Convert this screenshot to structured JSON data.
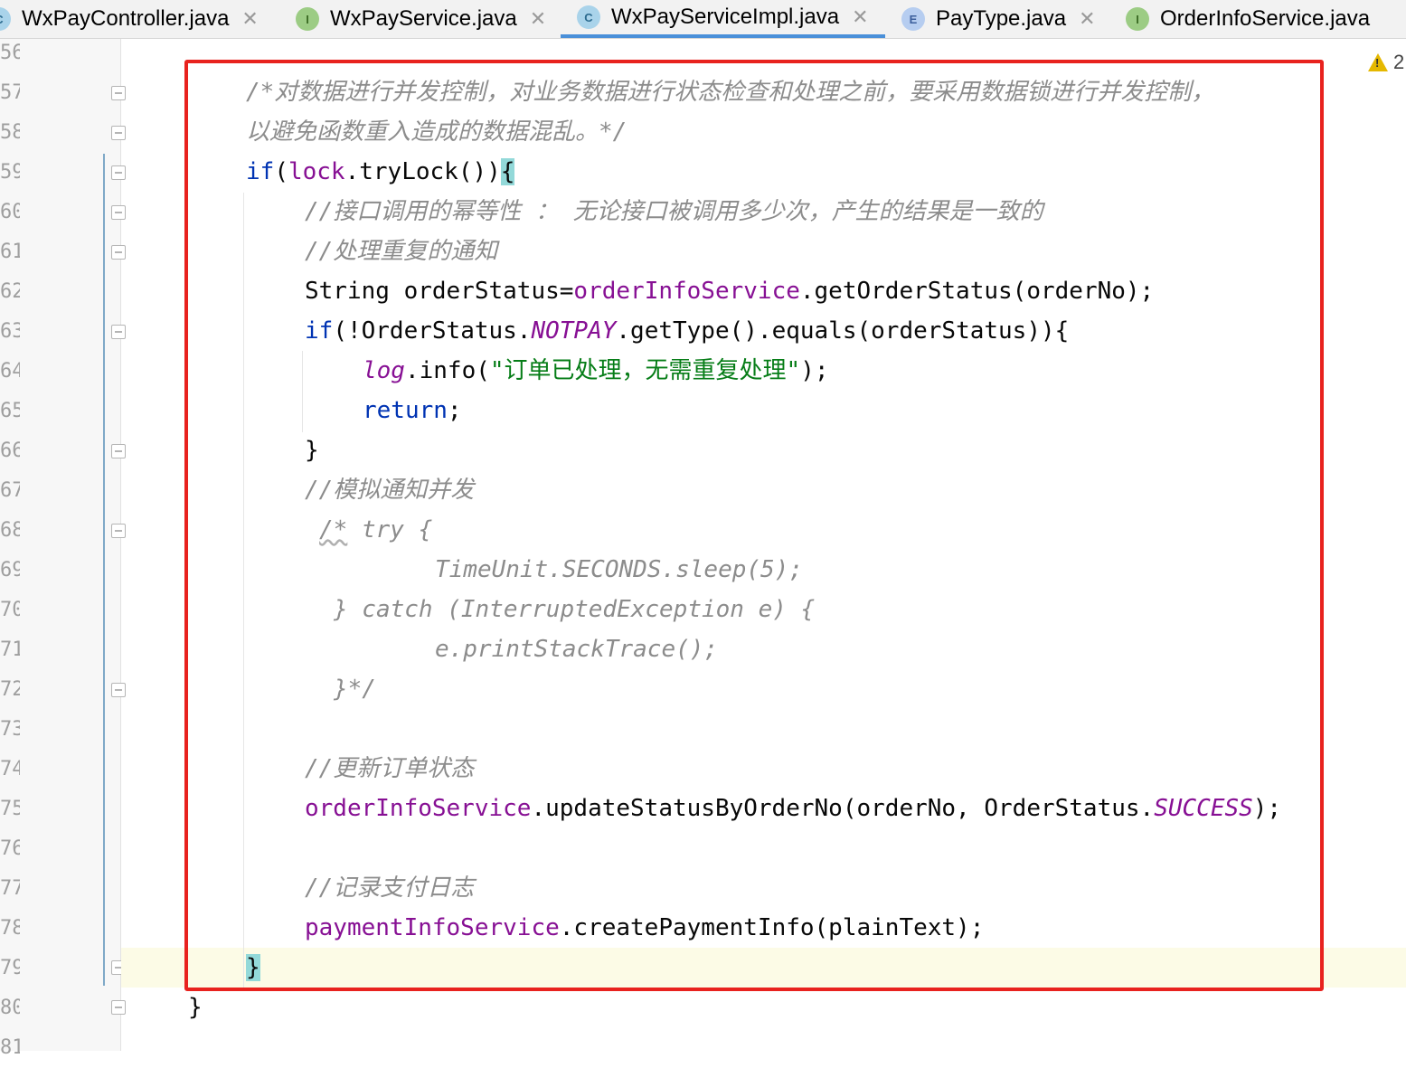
{
  "tabs": [
    {
      "icon": "C",
      "label": "WxPayController.java",
      "active": false
    },
    {
      "icon": "I",
      "label": "WxPayService.java",
      "active": false
    },
    {
      "icon": "C",
      "label": "WxPayServiceImpl.java",
      "active": true
    },
    {
      "icon": "E",
      "label": "PayType.java",
      "active": false
    },
    {
      "icon": "I",
      "label": "OrderInfoService.java",
      "active": false
    }
  ],
  "warnings": {
    "count": "2"
  },
  "gutter": {
    "line_numbers": [
      "56",
      "57",
      "58",
      "59",
      "60",
      "61",
      "62",
      "63",
      "64",
      "65",
      "66",
      "67",
      "68",
      "69",
      "70",
      "71",
      "72",
      "73",
      "74",
      "75",
      "76",
      "77",
      "78",
      "79",
      "80",
      "81"
    ]
  },
  "code": {
    "c1": "/*对数据进行并发控制，对业务数据进行状态检查和处理之前，要采用数据锁进行并发控制，",
    "c2": "以避免函数重入造成的数据混乱。*/",
    "if_kw": "if",
    "lock_open": "(",
    "lock": "lock",
    "trylock": ".tryLock())",
    "brace_open": "{",
    "c3": "//接口调用的幂等性 ： 无论接口被调用多少次，产生的结果是一致的",
    "c4": "//处理重复的通知",
    "s1a": "String orderStatus=",
    "s1b": "orderInfoService",
    "s1c": ".getOrderStatus(orderNo);",
    "s2a": "if",
    "s2b": "(!OrderStatus.",
    "s2c": "NOTPAY",
    "s2d": ".getType().equals(orderStatus)){",
    "s3a": "log",
    "s3b": ".info(",
    "s3c": "\"订单已处理，无需重复处理\"",
    "s3d": ");",
    "s4": "return",
    "s4b": ";",
    "close1": "}",
    "c5": "//模拟通知并发",
    "c6a": "/*",
    "c6b": " try {",
    "c7": "TimeUnit.SECONDS.sleep(5);",
    "c8": "} catch (InterruptedException e) {",
    "c9": "e.printStackTrace();",
    "c10": "}*/",
    "c11": "//更新订单状态",
    "s5a": "orderInfoService",
    "s5b": ".updateStatusByOrderNo(orderNo, OrderStatus.",
    "s5c": "SUCCESS",
    "s5d": ");",
    "c12": "//记录支付日志",
    "s6a": "paymentInfoService",
    "s6b": ".createPaymentInfo(plainText);",
    "close2": "}",
    "close3": "}"
  },
  "colors": {
    "keyword": "#0033b3",
    "field": "#871094",
    "string": "#067d17",
    "comment": "#8c8c8c",
    "highlight_box": "#e8221e",
    "brace_match": "#93d9d9"
  }
}
